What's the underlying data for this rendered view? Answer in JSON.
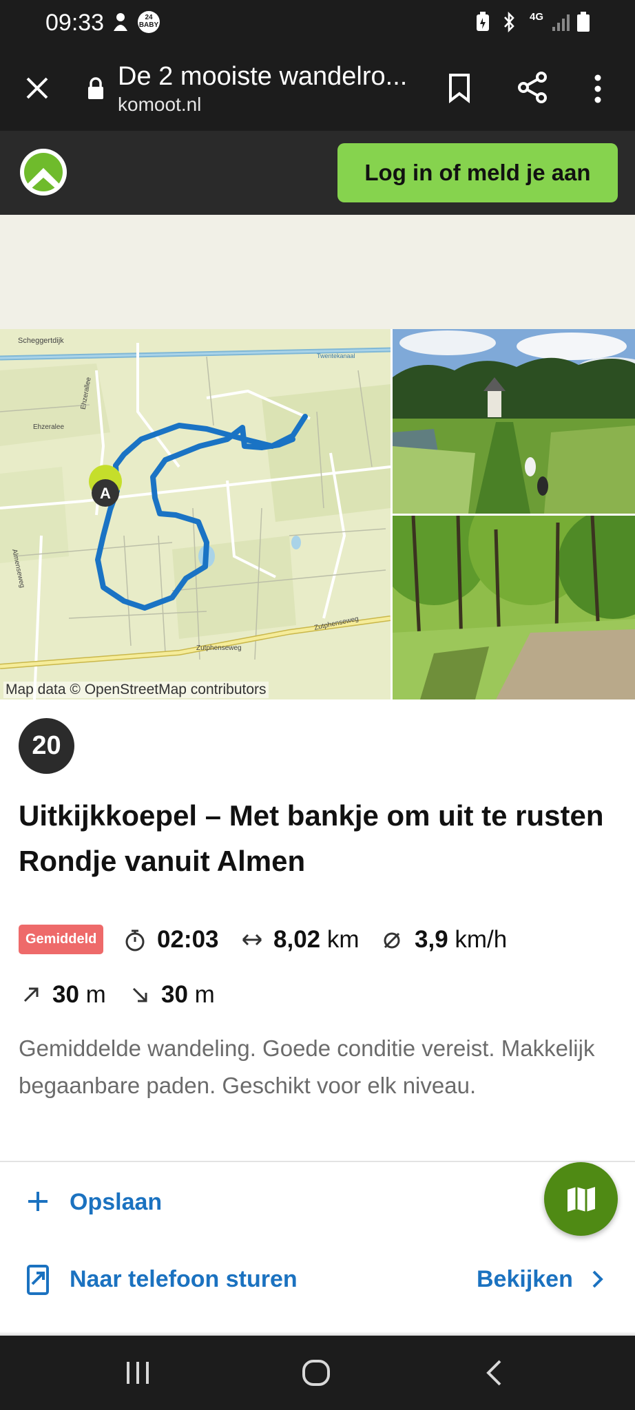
{
  "status_bar": {
    "time": "09:33",
    "network": "4G"
  },
  "browser": {
    "title": "De 2 mooiste wandelro...",
    "domain": "komoot.nl"
  },
  "site_header": {
    "login_label": "Log in of meld je aan"
  },
  "map": {
    "attribution": "Map data © OpenStreetMap contributors",
    "start_marker": "A",
    "labels": [
      "Scheggertdijk",
      "Twentekanaal",
      "Ehzeralee",
      "Ehzerallee",
      "Almenseweg",
      "Zutphenseweg",
      "Zutphenseweg"
    ]
  },
  "tour": {
    "rank": "20",
    "title": "Uitkijkkoepel – Met bankje om uit te rusten Rondje vanuit Almen",
    "difficulty": "Gemiddeld",
    "duration": "02:03",
    "distance_value": "8,02",
    "distance_unit": "km",
    "speed_value": "3,9",
    "speed_unit": "km/h",
    "ascent_value": "30",
    "ascent_unit": "m",
    "descent_value": "30",
    "descent_unit": "m",
    "description": "Gemiddelde wandeling. Goede conditie vereist. Makkelijk begaanbare paden. Geschikt voor elk niveau."
  },
  "actions": {
    "save_label": "Opslaan",
    "send_label": "Naar telefoon sturen",
    "view_label": "Bekijken"
  },
  "colors": {
    "brand_green": "#86d34e",
    "fab_green": "#4f8a14",
    "link_blue": "#1b72c0",
    "difficulty_red": "#ee6a6a",
    "route_blue": "#1a73c4"
  }
}
